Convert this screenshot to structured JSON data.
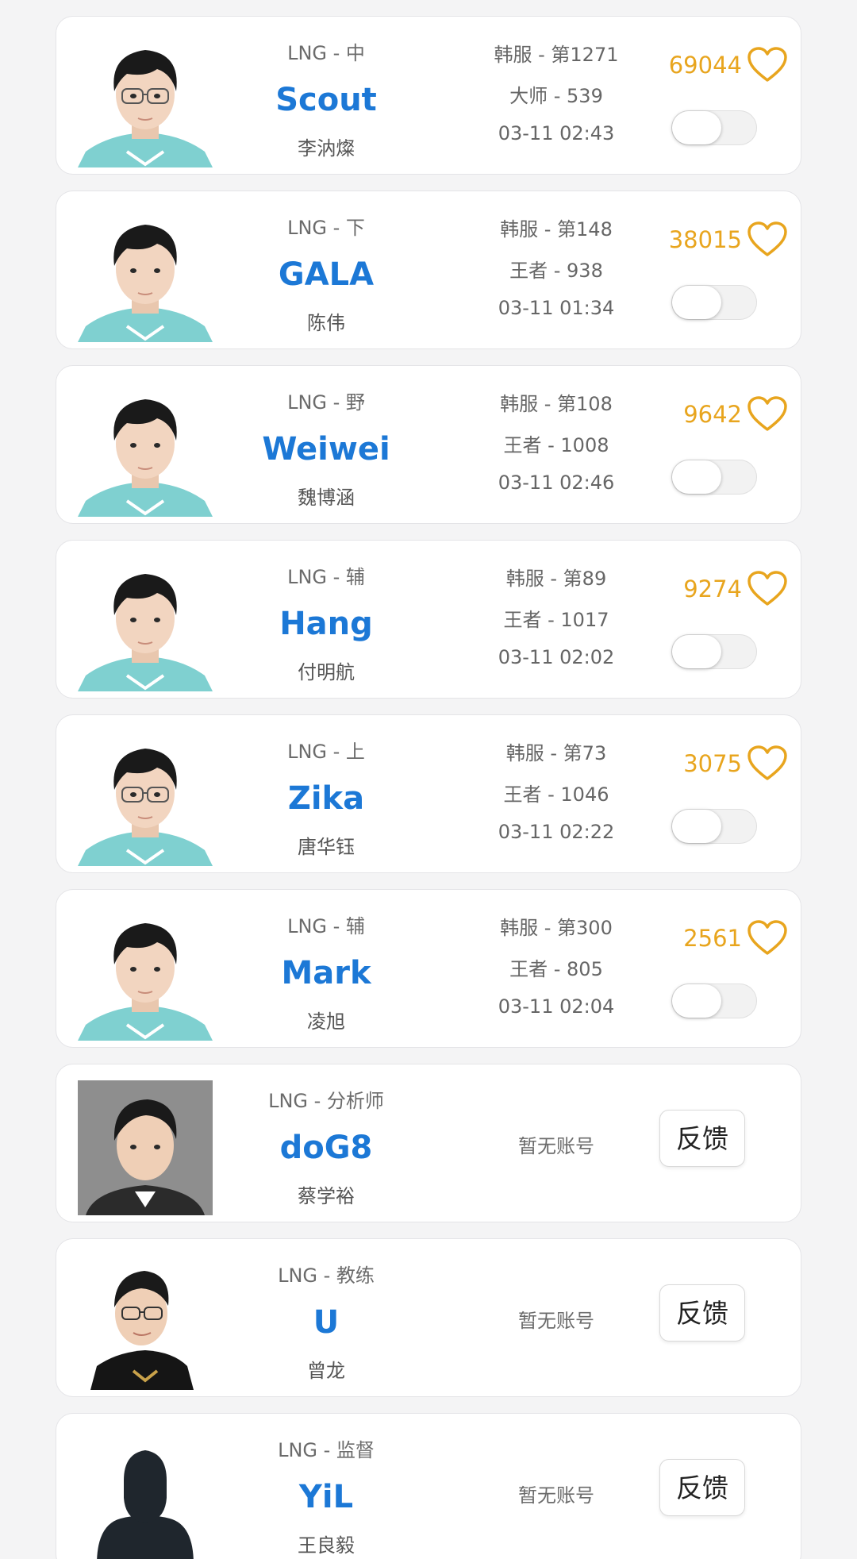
{
  "players": [
    {
      "role": "LNG - 中",
      "nick": "Scout",
      "real_name": "李汭燦",
      "server": "韩服 - 第1271",
      "rank": "大师 - 539",
      "time": "03-11 02:43",
      "likes": "69044",
      "avatar": "player-photo"
    },
    {
      "role": "LNG - 下",
      "nick": "GALA",
      "real_name": "陈伟",
      "server": "韩服 - 第148",
      "rank": "王者 - 938",
      "time": "03-11 01:34",
      "likes": "38015",
      "avatar": "player-photo"
    },
    {
      "role": "LNG - 野",
      "nick": "Weiwei",
      "real_name": "魏博涵",
      "server": "韩服 - 第108",
      "rank": "王者 - 1008",
      "time": "03-11 02:46",
      "likes": "9642",
      "avatar": "player-photo"
    },
    {
      "role": "LNG - 辅",
      "nick": "Hang",
      "real_name": "付明航",
      "server": "韩服 - 第89",
      "rank": "王者 - 1017",
      "time": "03-11 02:02",
      "likes": "9274",
      "avatar": "player-photo"
    },
    {
      "role": "LNG - 上",
      "nick": "Zika",
      "real_name": "唐华钰",
      "server": "韩服 - 第73",
      "rank": "王者 - 1046",
      "time": "03-11 02:22",
      "likes": "3075",
      "avatar": "player-photo"
    },
    {
      "role": "LNG - 辅",
      "nick": "Mark",
      "real_name": "凌旭",
      "server": "韩服 - 第300",
      "rank": "王者 - 805",
      "time": "03-11 02:04",
      "likes": "2561",
      "avatar": "player-photo"
    }
  ],
  "staff": [
    {
      "role": "LNG - 分析师",
      "nick": "doG8",
      "real_name": "蔡学裕",
      "account_status": "暂无账号",
      "feedback_label": "反馈",
      "avatar": "staff-photo-gray"
    },
    {
      "role": "LNG - 教练",
      "nick": "U",
      "real_name": "曾龙",
      "account_status": "暂无账号",
      "feedback_label": "反馈",
      "avatar": "staff-photo-jersey"
    },
    {
      "role": "LNG - 监督",
      "nick": "YiL",
      "real_name": "王良毅",
      "account_status": "暂无账号",
      "feedback_label": "反馈",
      "avatar": "default-avatar-silhouette"
    }
  ],
  "colors": {
    "nick": "#1c78d6",
    "likes": "#e8a51e",
    "jersey": "#7fd0d0",
    "hair": "#1a1a1a"
  }
}
